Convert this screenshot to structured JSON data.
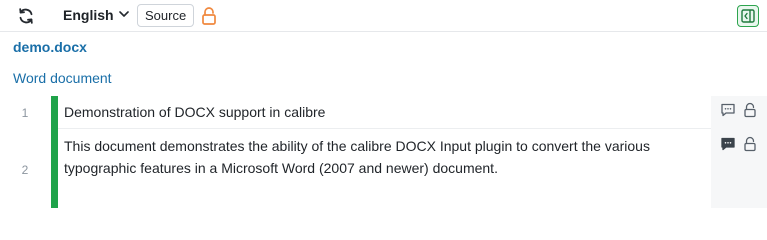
{
  "toolbar": {
    "refresh_icon": "refresh-icon",
    "language": "English",
    "language_icon": "chevron-down-icon",
    "source_label": "Source",
    "lock_icon": "lock-open-icon",
    "panel_icon": "panel-collapse-icon"
  },
  "document": {
    "filename": "demo.docx",
    "type": "Word document"
  },
  "segments": [
    {
      "number": "1",
      "text": "Demonstration of DOCX support in calibre",
      "comment_icon": "comment-icon",
      "lock_icon": "lock-open-icon"
    },
    {
      "number": "2",
      "text": "This document demonstrates the ability of the calibre DOCX Input plugin to convert the various typographic features in a Microsoft Word (2007 and newer) document.",
      "comment_icon": "comment-filled-icon",
      "lock_icon": "lock-open-icon"
    }
  ],
  "colors": {
    "accent_blue": "#1a6fa8",
    "status_green": "#1fa34a",
    "lock_orange": "#f0883e"
  }
}
